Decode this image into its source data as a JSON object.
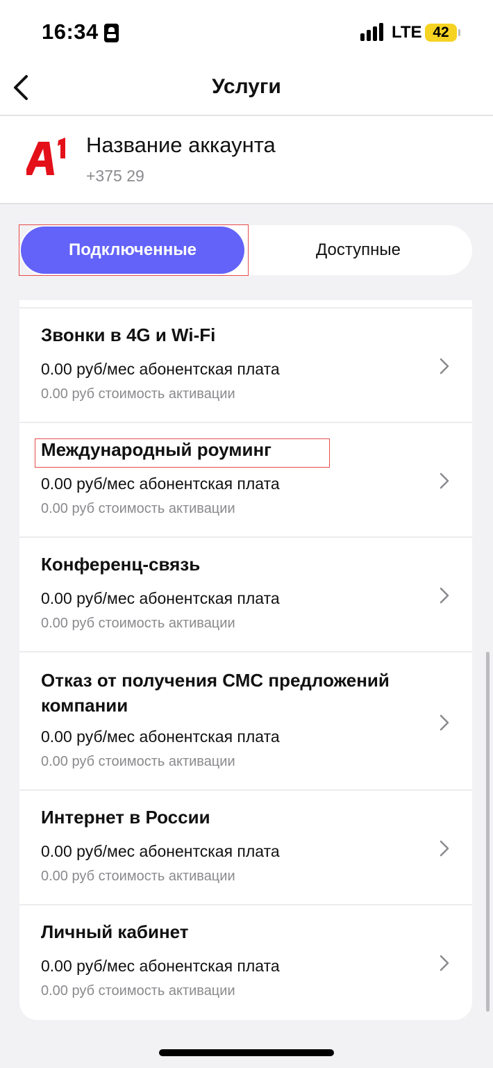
{
  "status_bar": {
    "time": "16:34",
    "network": "LTE",
    "battery": "42",
    "icons": [
      "sim-card-icon",
      "signal-icon",
      "battery-charging-icon"
    ]
  },
  "header": {
    "title": "Услуги",
    "back_icon": "chevron-left-icon"
  },
  "account": {
    "name": "Название аккаунта",
    "phone": "+375 29",
    "logo": "A1",
    "logo_color": "#e3101a"
  },
  "tabs": [
    {
      "label": "Подключенные",
      "active": true
    },
    {
      "label": "Доступные",
      "active": false
    }
  ],
  "colors": {
    "accent": "#6363f9",
    "highlight": "#e84a4a",
    "background": "#f2f2f4"
  },
  "services": [
    {
      "title": "Звонки в 4G и Wi-Fi",
      "fee": "0.00 руб/мес абонентская плата",
      "activation": "0.00 руб стоимость активации"
    },
    {
      "title": "Международный роуминг",
      "fee": "0.00 руб/мес абонентская плата",
      "activation": "0.00 руб стоимость активации"
    },
    {
      "title": "Конференц-связь",
      "fee": "0.00 руб/мес абонентская плата",
      "activation": "0.00 руб стоимость активации"
    },
    {
      "title": "Отказ от получения СМС предложений компании",
      "fee": "0.00 руб/мес абонентская плата",
      "activation": "0.00 руб стоимость активации"
    },
    {
      "title": "Интернет в России",
      "fee": "0.00 руб/мес абонентская плата",
      "activation": "0.00 руб стоимость активации"
    },
    {
      "title": "Личный кабинет",
      "fee": "0.00 руб/мес абонентская плата",
      "activation": "0.00 руб стоимость активации"
    }
  ]
}
